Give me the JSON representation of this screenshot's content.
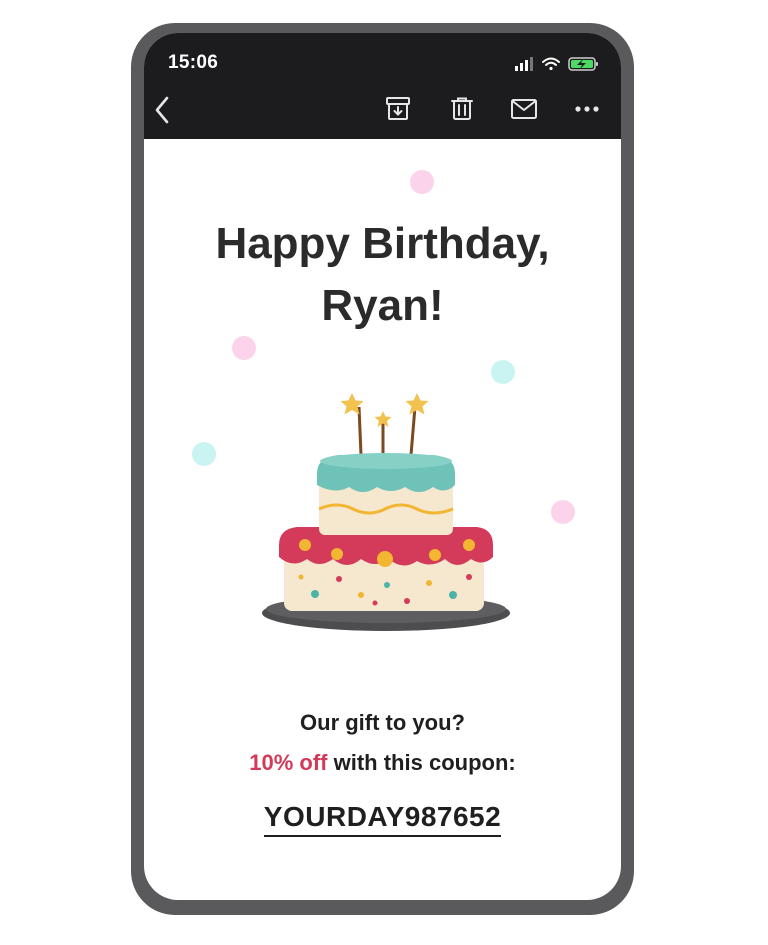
{
  "status_bar": {
    "time": "15:06",
    "icons": [
      "signal-icon",
      "wifi-icon",
      "battery-charging-icon"
    ]
  },
  "toolbar": {
    "icons": [
      "back-chevron-icon",
      "archive-icon",
      "trash-icon",
      "mail-icon",
      "more-icon"
    ]
  },
  "email": {
    "heading_line1": "Happy Birthday,",
    "heading_line2": "Ryan!",
    "gift_question": "Our gift to you?",
    "discount": "10% off",
    "discount_suffix": " with this coupon:",
    "coupon_code": "YOURDAY987652"
  },
  "colors": {
    "toolbar_bg": "#1c1c1e",
    "accent": "#d43a59",
    "frame": "#5a5a5d",
    "confetti_pink": "#fbd3ea",
    "confetti_cyan": "#c9f4f2"
  }
}
